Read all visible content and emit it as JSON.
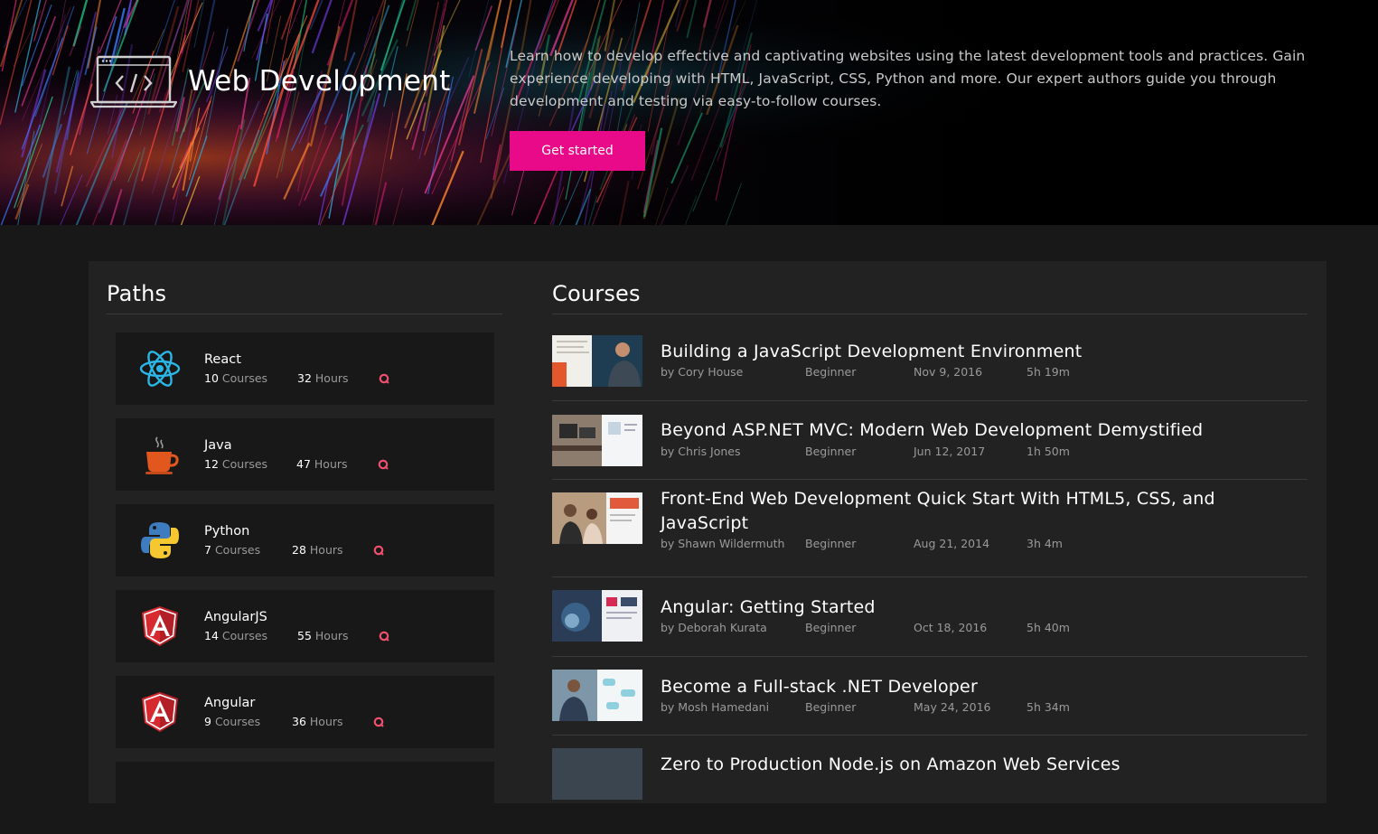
{
  "hero": {
    "title": "Web Development",
    "icon": "code-monitor-icon",
    "description": "Learn how to develop effective and captivating websites using the latest development tools and practices. Gain experience developing with HTML, JavaScript, CSS, Python and more. Our expert authors guide you through development and testing via easy-to-follow courses.",
    "cta_label": "Get started",
    "accent": "#e80a89"
  },
  "paths": {
    "title": "Paths",
    "items": [
      {
        "name": "React",
        "courses": "10",
        "courses_label": "Courses",
        "hours": "32",
        "hours_label": "Hours",
        "icon": "react-icon"
      },
      {
        "name": "Java",
        "courses": "12",
        "courses_label": "Courses",
        "hours": "47",
        "hours_label": "Hours",
        "icon": "java-icon"
      },
      {
        "name": "Python",
        "courses": "7",
        "courses_label": "Courses",
        "hours": "28",
        "hours_label": "Hours",
        "icon": "python-icon"
      },
      {
        "name": "AngularJS",
        "courses": "14",
        "courses_label": "Courses",
        "hours": "55",
        "hours_label": "Hours",
        "icon": "angular-icon"
      },
      {
        "name": "Angular",
        "courses": "9",
        "courses_label": "Courses",
        "hours": "36",
        "hours_label": "Hours",
        "icon": "angular-icon"
      }
    ]
  },
  "courses": {
    "title": "Courses",
    "items": [
      {
        "title": "Building a JavaScript Development Environment",
        "author": "by Cory House",
        "level": "Beginner",
        "date": "Nov 9, 2016",
        "duration": "5h 19m"
      },
      {
        "title": "Beyond ASP.NET MVC: Modern Web Development Demystified",
        "author": "by Chris Jones",
        "level": "Beginner",
        "date": "Jun 12, 2017",
        "duration": "1h 50m"
      },
      {
        "title": "Front-End Web Development Quick Start With HTML5, CSS, and JavaScript",
        "author": "by Shawn Wildermuth",
        "level": "Beginner",
        "date": "Aug 21, 2014",
        "duration": "3h 4m"
      },
      {
        "title": "Angular: Getting Started",
        "author": "by Deborah Kurata",
        "level": "Beginner",
        "date": "Oct 18, 2016",
        "duration": "5h 40m"
      },
      {
        "title": "Become a Full-stack .NET Developer",
        "author": "by Mosh Hamedani",
        "level": "Beginner",
        "date": "May 24, 2016",
        "duration": "5h 34m"
      },
      {
        "title": "Zero to Production Node.js on Amazon Web Services",
        "author": "",
        "level": "",
        "date": "",
        "duration": ""
      }
    ]
  }
}
